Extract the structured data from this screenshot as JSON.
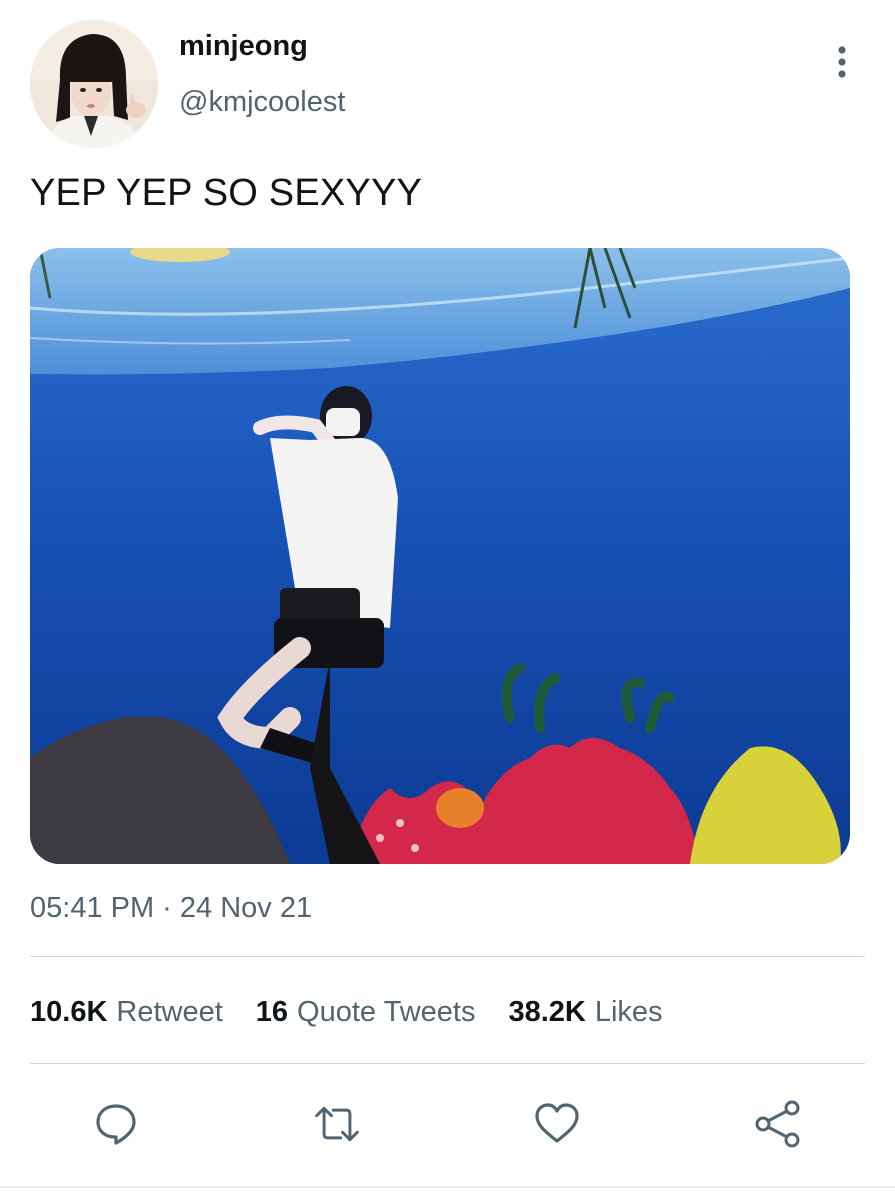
{
  "tweet": {
    "author": {
      "display_name": "minjeong",
      "handle": "@kmjcoolest",
      "avatar_icon": "profile-photo"
    },
    "text": "YEP YEP SO SEXYYY",
    "media": {
      "description_icon": "photo",
      "colors": {
        "water_deep": "#0d3d9a",
        "water_mid": "#1b5cc4",
        "surface": "#7fb6e6",
        "coral_red": "#d3284a",
        "coral_yellow": "#d8d23a"
      }
    },
    "timestamp": "05:41 PM · 24 Nov 21",
    "stats": {
      "retweets": {
        "count": "10.6K",
        "label": "Retweet"
      },
      "quotes": {
        "count": "16",
        "label": "Quote Tweets"
      },
      "likes": {
        "count": "38.2K",
        "label": "Likes"
      }
    },
    "actions": [
      {
        "icon": "reply-icon"
      },
      {
        "icon": "retweet-icon"
      },
      {
        "icon": "like-icon"
      },
      {
        "icon": "share-icon"
      }
    ]
  },
  "theme": {
    "text_primary": "#0f1419",
    "text_secondary": "#536471",
    "divider": "#cfd9de"
  }
}
